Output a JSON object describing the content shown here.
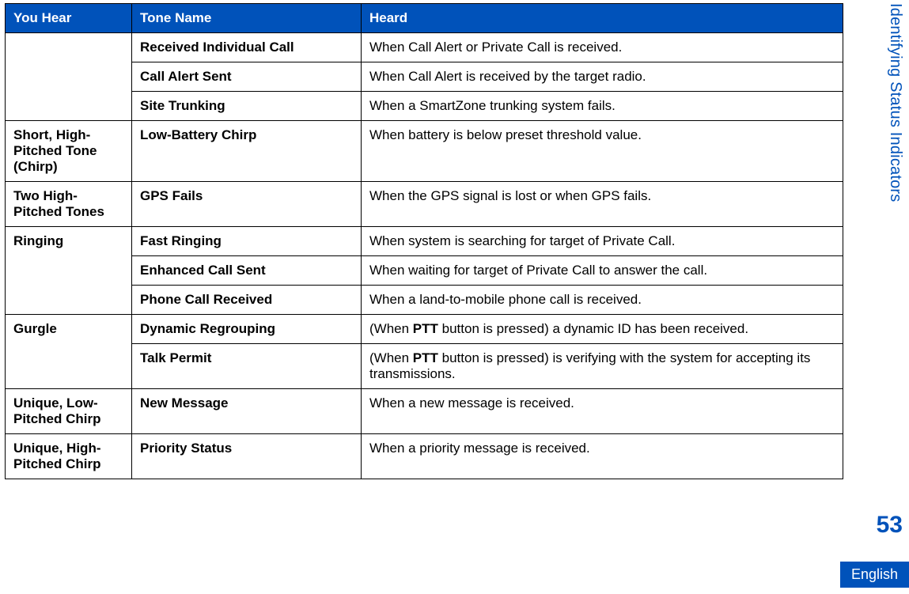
{
  "header": {
    "you_hear": "You Hear",
    "tone_name": "Tone Name",
    "heard": "Heard"
  },
  "rows": [
    {
      "you_hear": "",
      "tone_name": "Received Individual Call",
      "heard": "When Call Alert or Private Call is received."
    },
    {
      "you_hear": "",
      "tone_name": "Call Alert Sent",
      "heard": "When Call Alert is received by the target radio."
    },
    {
      "you_hear": "",
      "tone_name": "Site Trunking",
      "heard": "When a SmartZone trunking system fails."
    },
    {
      "you_hear": "Short, High-Pitched Tone (Chirp)",
      "tone_name": "Low-Battery Chirp",
      "heard": "When battery is below preset threshold value."
    },
    {
      "you_hear": "Two High-Pitched Tones",
      "tone_name": "GPS Fails",
      "heard": "When the GPS signal is lost or when GPS fails."
    },
    {
      "you_hear": "Ringing",
      "tone_name": "Fast Ringing",
      "heard": "When system is searching for target of Private Call."
    },
    {
      "you_hear": "",
      "tone_name": "Enhanced Call Sent",
      "heard": "When waiting for target of Private Call to answer the call."
    },
    {
      "you_hear": "",
      "tone_name": "Phone Call Received",
      "heard": "When a land-to-mobile phone call is received."
    },
    {
      "you_hear": "Gurgle",
      "tone_name": "Dynamic Regrouping",
      "heard_pre": "(When ",
      "heard_bold": "PTT",
      "heard_post": " button is pressed) a dynamic ID has been received."
    },
    {
      "you_hear": "",
      "tone_name": "Talk Permit",
      "heard_pre": "(When ",
      "heard_bold": "PTT",
      "heard_post": " button is pressed) is verifying with the system for accepting its transmissions."
    },
    {
      "you_hear": "Unique, Low-Pitched Chirp",
      "tone_name": "New Message",
      "heard": "When a new message is received."
    },
    {
      "you_hear": "Unique, High-Pitched Chirp",
      "tone_name": "Priority Status",
      "heard": "When a priority message is received."
    }
  ],
  "rail": {
    "section_title": "Identifying Status Indicators",
    "page_number": "53",
    "language": "English"
  }
}
